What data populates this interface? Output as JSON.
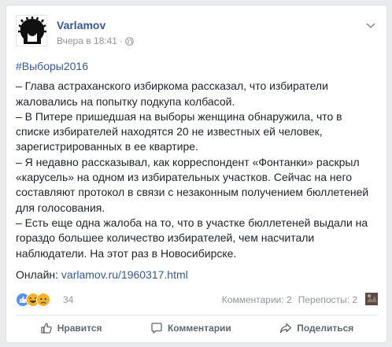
{
  "post": {
    "author": "Varlamov",
    "time": "Вчера в 18:41",
    "meta_separator": "·",
    "hashtag": "#Выборы2016",
    "paragraphs": [
      "– Глава астраханского избиркома рассказал, что избиратели жаловались на попытку подкупа колбасой.",
      "– В Питере пришедшая на выборы женщина обнаружила, что в списке избирателей находятся 20 не известных ей человек, зарегистрированных в ее квартире.",
      "– Я недавно рассказывал, как корреспондент «Фонтанки» раскрыл «карусель» на одном из избирательных участков. Сейчас на него составляют протокол в связи с незаконным получением бюллетеней для голосования.",
      "– Есть еще одна жалоба на то, что в участке бюллетеней выдали на гораздо большее количество избирателей, чем насчитали наблюдатели. На этот раз в Новосибирске."
    ],
    "online_label": "Онлайн:",
    "online_link": "varlamov.ru/1960317.html"
  },
  "stats": {
    "reaction_count": "34",
    "comments": "Комментарии: 2",
    "shares": "Перепосты: 2"
  },
  "actions": {
    "like": "Нравится",
    "comment": "Комментарии",
    "share": "Поделиться"
  },
  "colors": {
    "link": "#365899",
    "meta": "#90949c",
    "action": "#606770",
    "like_blue": "#5890ff",
    "haha_yellow": "#f7b125"
  },
  "icons": [
    "globe-icon",
    "chevron-down-icon",
    "like-reaction-icon",
    "haha-reaction-icon",
    "sad-reaction-icon",
    "thumbs-up-icon",
    "comment-icon",
    "share-icon"
  ]
}
